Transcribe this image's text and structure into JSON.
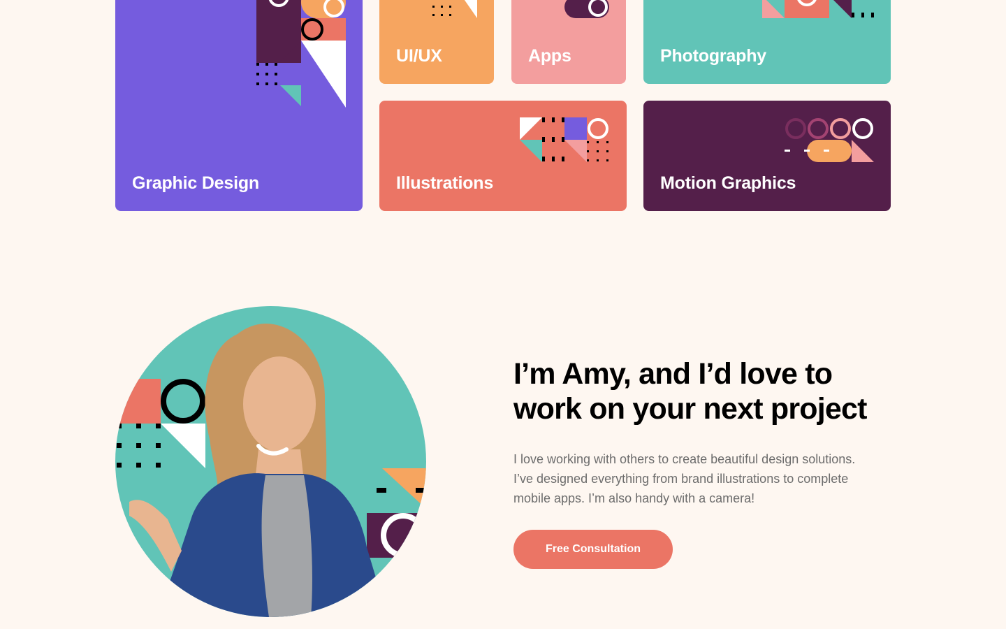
{
  "colors": {
    "background": "#FEF7F1",
    "purple": "#755CDE",
    "orange": "#F6A560",
    "pink": "#F39E9E",
    "teal": "#61C4B7",
    "coral": "#EB7565",
    "plum": "#541F4A",
    "heading": "#000000",
    "body_text": "#6C6C6C"
  },
  "categories": [
    {
      "id": "graphic-design",
      "label": "Graphic Design",
      "color": "#755CDE"
    },
    {
      "id": "ui-ux",
      "label": "UI/UX",
      "color": "#F6A560"
    },
    {
      "id": "apps",
      "label": "Apps",
      "color": "#F39E9E"
    },
    {
      "id": "photography",
      "label": "Photography",
      "color": "#61C4B7"
    },
    {
      "id": "illustrations",
      "label": "Illustrations",
      "color": "#EB7565"
    },
    {
      "id": "motion-graphics",
      "label": "Motion Graphics",
      "color": "#541F4A"
    }
  ],
  "about": {
    "title_lines": [
      "I’m Amy, and I’d love to",
      "work on your next project"
    ],
    "text_lines": [
      "I love working with others to create beautiful design solutions.",
      "I’ve designed everything from brand illustrations to complete",
      "mobile apps. I’m also handy with a camera!"
    ],
    "cta_label": "Free Consultation",
    "portrait_icon": "person-photo-icon"
  }
}
